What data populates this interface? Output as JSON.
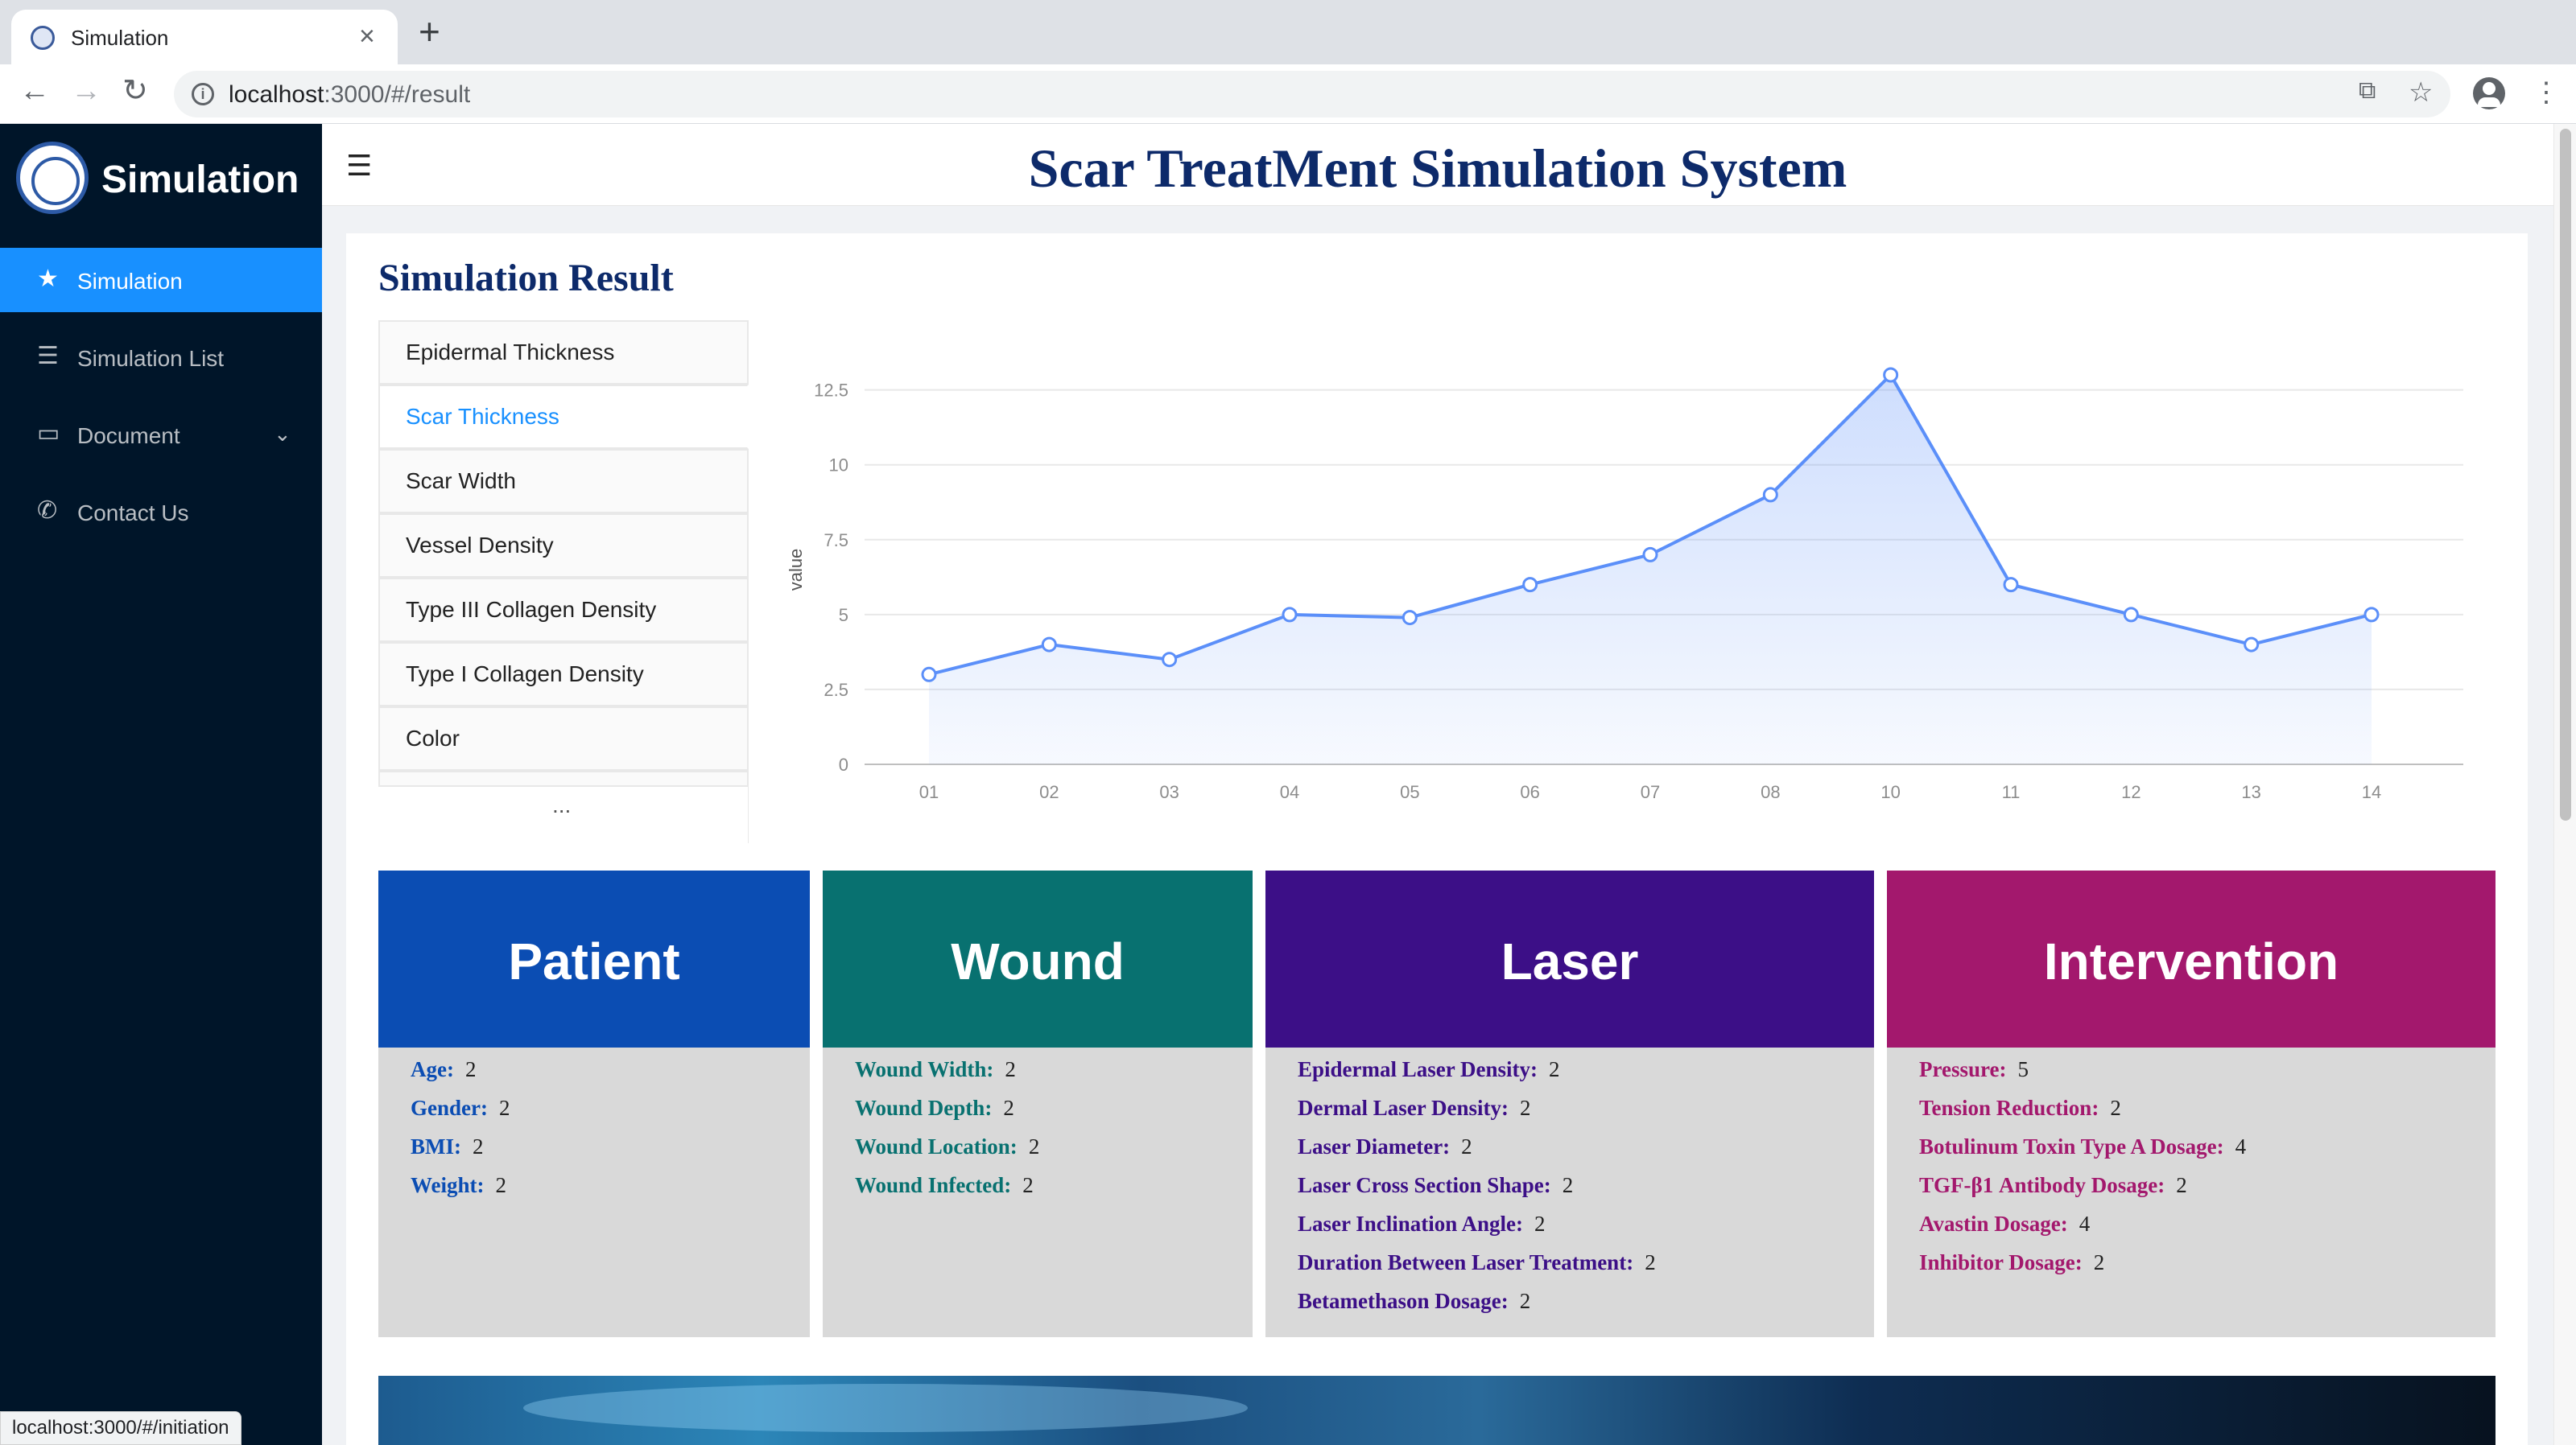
{
  "browser": {
    "tab_title": "Simulation",
    "tab_close": "×",
    "new_tab": "+",
    "url_host": "localhost",
    "url_rest": ":3000/#/result"
  },
  "sidebar": {
    "brand": "Simulation",
    "items": [
      {
        "label": "Simulation",
        "icon": "star-icon"
      },
      {
        "label": "Simulation List",
        "icon": "list-icon"
      },
      {
        "label": "Document",
        "icon": "folder-icon"
      },
      {
        "label": "Contact Us",
        "icon": "phone-icon"
      }
    ]
  },
  "header": {
    "title": "Scar TreatMent Simulation System"
  },
  "result": {
    "title": "Simulation Result",
    "metrics": [
      "Epidermal Thickness",
      "Scar Thickness",
      "Scar Width",
      "Vessel Density",
      "Type III Collagen Density",
      "Type I Collagen Density",
      "Color"
    ],
    "active_metric": "Scar Thickness",
    "more": "..."
  },
  "chart_data": {
    "type": "area",
    "categories": [
      "01",
      "02",
      "03",
      "04",
      "05",
      "06",
      "07",
      "08",
      "10",
      "11",
      "12",
      "13",
      "14"
    ],
    "values": [
      3,
      4,
      3.5,
      5,
      4.9,
      6,
      7,
      9,
      13,
      6,
      5,
      4,
      5
    ],
    "ylabel": "value",
    "ylim": [
      0,
      12.5
    ],
    "yticks": [
      "0",
      "2.5",
      "5",
      "7.5",
      "10",
      "12.5"
    ],
    "grid": true,
    "color": "#5b8ff9"
  },
  "panels": {
    "patient": {
      "title": "Patient",
      "color": "#0b4db3",
      "fields": [
        {
          "k": "Age:",
          "v": "2"
        },
        {
          "k": "Gender:",
          "v": "2"
        },
        {
          "k": "BMI:",
          "v": "2"
        },
        {
          "k": "Weight:",
          "v": "2"
        }
      ]
    },
    "wound": {
      "title": "Wound",
      "color": "#087170",
      "fields": [
        {
          "k": "Wound Width:",
          "v": "2"
        },
        {
          "k": "Wound Depth:",
          "v": "2"
        },
        {
          "k": "Wound Location:",
          "v": "2"
        },
        {
          "k": "Wound Infected:",
          "v": "2"
        }
      ]
    },
    "laser": {
      "title": "Laser",
      "color": "#3c0f87",
      "fields": [
        {
          "k": "Epidermal Laser Density:",
          "v": "2"
        },
        {
          "k": "Dermal Laser Density:",
          "v": "2"
        },
        {
          "k": "Laser Diameter:",
          "v": "2"
        },
        {
          "k": "Laser Cross Section Shape:",
          "v": "2"
        },
        {
          "k": "Laser Inclination Angle:",
          "v": "2"
        },
        {
          "k": "Duration Between Laser Treatment:",
          "v": "2"
        },
        {
          "k": "Betamethason Dosage:",
          "v": "2"
        }
      ]
    },
    "intervention": {
      "title": "Intervention",
      "color": "#a3186d",
      "fields": [
        {
          "k": "Pressure:",
          "v": "5"
        },
        {
          "k": "Tension Reduction:",
          "v": "2"
        },
        {
          "k": "Botulinum Toxin Type A Dosage:",
          "v": "4"
        },
        {
          "k": "TGF-β1 Antibody Dosage:",
          "v": "2"
        },
        {
          "k": "Avastin Dosage:",
          "v": "4"
        },
        {
          "k": "Inhibitor Dosage:",
          "v": "2"
        }
      ]
    }
  },
  "status_url": "localhost:3000/#/initiation"
}
